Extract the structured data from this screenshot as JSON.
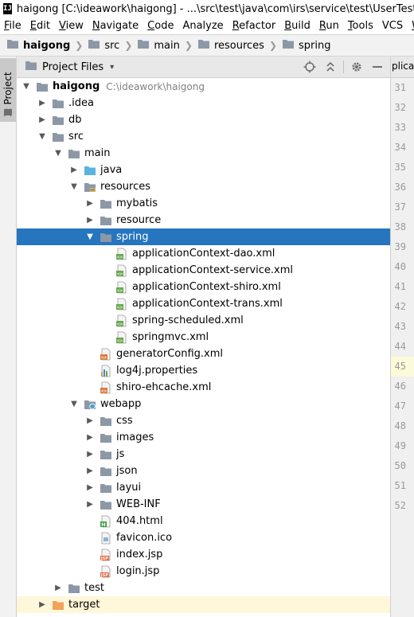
{
  "window": {
    "title": "haigong [C:\\ideawork\\haigong] - ...\\src\\test\\java\\com\\irs\\service\\test\\UserTest.java [h",
    "logo_text": "IJ"
  },
  "menu": [
    {
      "mnemonic": "F",
      "rest": "ile"
    },
    {
      "mnemonic": "E",
      "rest": "dit"
    },
    {
      "mnemonic": "V",
      "rest": "iew"
    },
    {
      "mnemonic": "N",
      "rest": "avigate"
    },
    {
      "mnemonic": "C",
      "rest": "ode"
    },
    {
      "mnemonic": "",
      "rest": "Analyze"
    },
    {
      "mnemonic": "R",
      "rest": "efactor"
    },
    {
      "mnemonic": "B",
      "rest": "uild"
    },
    {
      "mnemonic": "R",
      "rest": "un"
    },
    {
      "mnemonic": "T",
      "rest": "ools"
    },
    {
      "mnemonic": "",
      "rest": "VCS"
    },
    {
      "mnemonic": "W",
      "rest": "indow"
    }
  ],
  "breadcrumb": [
    "haigong",
    "src",
    "main",
    "resources",
    "spring"
  ],
  "left_stripe": {
    "tab_label": "1: Project"
  },
  "tool_window": {
    "title": "Project Files",
    "dropdown": "▾"
  },
  "editor": {
    "tab_label": "plicati",
    "line_numbers": [
      "31",
      "32",
      "33",
      "34",
      "35",
      "36",
      "37",
      "38",
      "39",
      "40",
      "41",
      "42",
      "43",
      "44",
      "45",
      "46",
      "47",
      "48",
      "49",
      "50",
      "51",
      "52"
    ],
    "current_line": "45"
  },
  "tree": [
    {
      "label": "haigong",
      "path": "C:\\ideawork\\haigong",
      "depth": 0,
      "arrow": "▼",
      "icon": "project-folder",
      "bold": true
    },
    {
      "label": ".idea",
      "depth": 1,
      "arrow": "▶",
      "icon": "folder"
    },
    {
      "label": "db",
      "depth": 1,
      "arrow": "▶",
      "icon": "folder"
    },
    {
      "label": "src",
      "depth": 1,
      "arrow": "▼",
      "icon": "folder"
    },
    {
      "label": "main",
      "depth": 2,
      "arrow": "▼",
      "icon": "folder"
    },
    {
      "label": "java",
      "depth": 3,
      "arrow": "▶",
      "icon": "source-folder"
    },
    {
      "label": "resources",
      "depth": 3,
      "arrow": "▼",
      "icon": "resources-folder"
    },
    {
      "label": "mybatis",
      "depth": 4,
      "arrow": "▶",
      "icon": "folder"
    },
    {
      "label": "resource",
      "depth": 4,
      "arrow": "▶",
      "icon": "folder"
    },
    {
      "label": "spring",
      "depth": 4,
      "arrow": "▼",
      "icon": "folder",
      "selected": true
    },
    {
      "label": "applicationContext-dao.xml",
      "depth": 5,
      "arrow": "",
      "icon": "spring-xml"
    },
    {
      "label": "applicationContext-service.xml",
      "depth": 5,
      "arrow": "",
      "icon": "spring-xml"
    },
    {
      "label": "applicationContext-shiro.xml",
      "depth": 5,
      "arrow": "",
      "icon": "spring-xml"
    },
    {
      "label": "applicationContext-trans.xml",
      "depth": 5,
      "arrow": "",
      "icon": "spring-xml"
    },
    {
      "label": "spring-scheduled.xml",
      "depth": 5,
      "arrow": "",
      "icon": "spring-xml"
    },
    {
      "label": "springmvc.xml",
      "depth": 5,
      "arrow": "",
      "icon": "spring-xml"
    },
    {
      "label": "generatorConfig.xml",
      "depth": 4,
      "arrow": "",
      "icon": "xml-file"
    },
    {
      "label": "log4j.properties",
      "depth": 4,
      "arrow": "",
      "icon": "properties-file"
    },
    {
      "label": "shiro-ehcache.xml",
      "depth": 4,
      "arrow": "",
      "icon": "xml-file"
    },
    {
      "label": "webapp",
      "depth": 3,
      "arrow": "▼",
      "icon": "web-folder"
    },
    {
      "label": "css",
      "depth": 4,
      "arrow": "▶",
      "icon": "folder"
    },
    {
      "label": "images",
      "depth": 4,
      "arrow": "▶",
      "icon": "folder"
    },
    {
      "label": "js",
      "depth": 4,
      "arrow": "▶",
      "icon": "folder"
    },
    {
      "label": "json",
      "depth": 4,
      "arrow": "▶",
      "icon": "folder"
    },
    {
      "label": "layui",
      "depth": 4,
      "arrow": "▶",
      "icon": "folder"
    },
    {
      "label": "WEB-INF",
      "depth": 4,
      "arrow": "▶",
      "icon": "folder"
    },
    {
      "label": "404.html",
      "depth": 4,
      "arrow": "",
      "icon": "html-file"
    },
    {
      "label": "favicon.ico",
      "depth": 4,
      "arrow": "",
      "icon": "image-file"
    },
    {
      "label": "index.jsp",
      "depth": 4,
      "arrow": "",
      "icon": "jsp-file"
    },
    {
      "label": "login.jsp",
      "depth": 4,
      "arrow": "",
      "icon": "jsp-file"
    },
    {
      "label": "test",
      "depth": 2,
      "arrow": "▶",
      "icon": "folder"
    },
    {
      "label": "target",
      "depth": 1,
      "arrow": "▶",
      "icon": "excluded-folder",
      "excluded": true
    }
  ],
  "colors": {
    "selection": "#2675bf",
    "folder": "#8c98a6",
    "source_folder": "#5ab4e0",
    "excluded_folder": "#f0a35a",
    "excluded_row": "#fff7d9"
  }
}
